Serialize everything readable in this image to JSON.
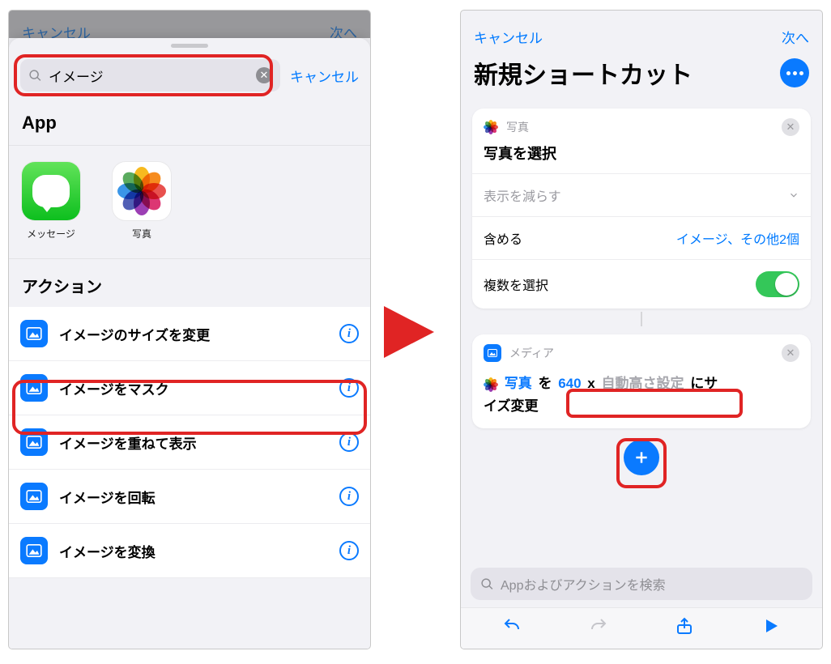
{
  "left": {
    "peek_cancel": "キャンセル",
    "peek_next": "次へ",
    "search_term": "イメージ",
    "search_cancel": "キャンセル",
    "section_app": "App",
    "apps": {
      "messages": "メッセージ",
      "photos": "写真"
    },
    "section_actions": "アクション",
    "actions": [
      "イメージのサイズを変更",
      "イメージをマスク",
      "イメージを重ねて表示",
      "イメージを回転",
      "イメージを変換"
    ]
  },
  "right": {
    "nav_cancel": "キャンセル",
    "nav_next": "次へ",
    "title": "新規ショートカット",
    "card1": {
      "source": "写真",
      "title": "写真を選択",
      "collapse": "表示を減らす",
      "include_k": "含める",
      "include_v": "イメージ、その他2個",
      "multi_k": "複数を選択"
    },
    "card2": {
      "source": "メディア",
      "t_photo": "写真",
      "t_wo": " を ",
      "t_width": "640",
      "t_x": " x ",
      "t_height": "自動高さ設定",
      "t_tail1": " にサ",
      "t_tail2": "イズ変更"
    },
    "search_placeholder": "Appおよびアクションを検索"
  }
}
